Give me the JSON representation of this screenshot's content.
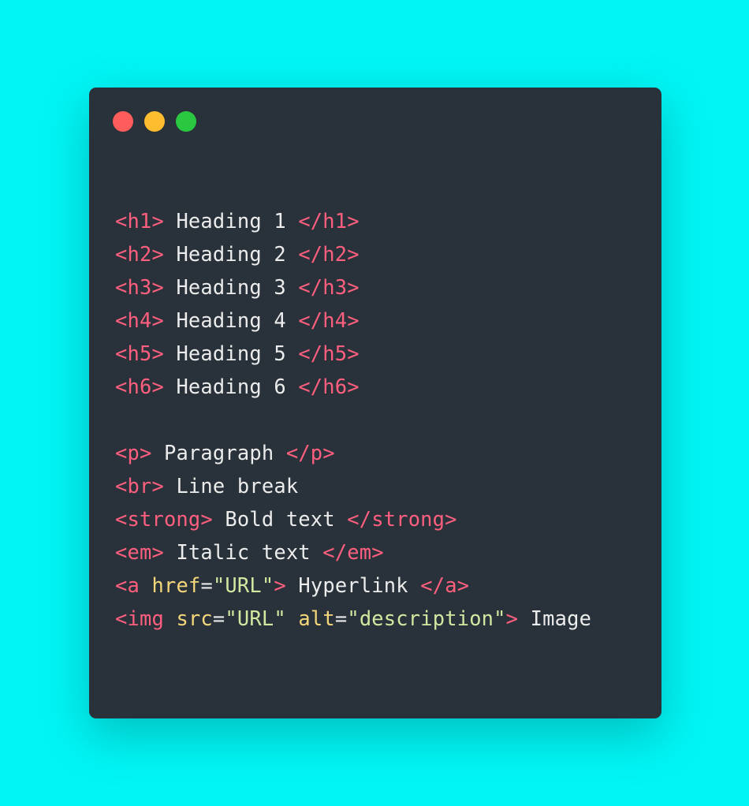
{
  "window": {
    "controls": [
      {
        "name": "close-dot",
        "color": "#ff5c5c"
      },
      {
        "name": "minimize-dot",
        "color": "#fdbd2e"
      },
      {
        "name": "maximize-dot",
        "color": "#2ac840"
      }
    ]
  },
  "colors": {
    "background": "#00f5f5",
    "panel": "#29323a",
    "tag": "#ff5f7e",
    "attribute": "#f4d77a",
    "string": "#d3e7a1",
    "text": "#ececec"
  },
  "code": {
    "h1": {
      "open": "<h1>",
      "text": " Heading 1 ",
      "close": "</h1>"
    },
    "h2": {
      "open": "<h2>",
      "text": " Heading 2 ",
      "close": "</h2>"
    },
    "h3": {
      "open": "<h3>",
      "text": " Heading 3 ",
      "close": "</h3>"
    },
    "h4": {
      "open": "<h4>",
      "text": " Heading 4 ",
      "close": "</h4>"
    },
    "h5": {
      "open": "<h5>",
      "text": " Heading 5 ",
      "close": "</h5>"
    },
    "h6": {
      "open": "<h6>",
      "text": " Heading 6 ",
      "close": "</h6>"
    },
    "p": {
      "open": "<p>",
      "text": " Paragraph ",
      "close": "</p>"
    },
    "br": {
      "open": "<br>",
      "text": " Line break"
    },
    "strong": {
      "open": "<strong>",
      "text": " Bold text ",
      "close": "</strong>"
    },
    "em": {
      "open": "<em>",
      "text": " Italic text ",
      "close": "</em>"
    },
    "a": {
      "open_start": "<a",
      "attr_name": "href",
      "eq": "=",
      "attr_value": "\"URL\"",
      "open_end": ">",
      "text": " Hyperlink ",
      "close": "</a>"
    },
    "img": {
      "open_start": "<img",
      "attr1_name": "src",
      "eq1": "=",
      "attr1_value": "\"URL\"",
      "attr2_name": "alt",
      "eq2": "=",
      "attr2_value": "\"description\"",
      "open_end": ">",
      "text": " Image"
    }
  }
}
